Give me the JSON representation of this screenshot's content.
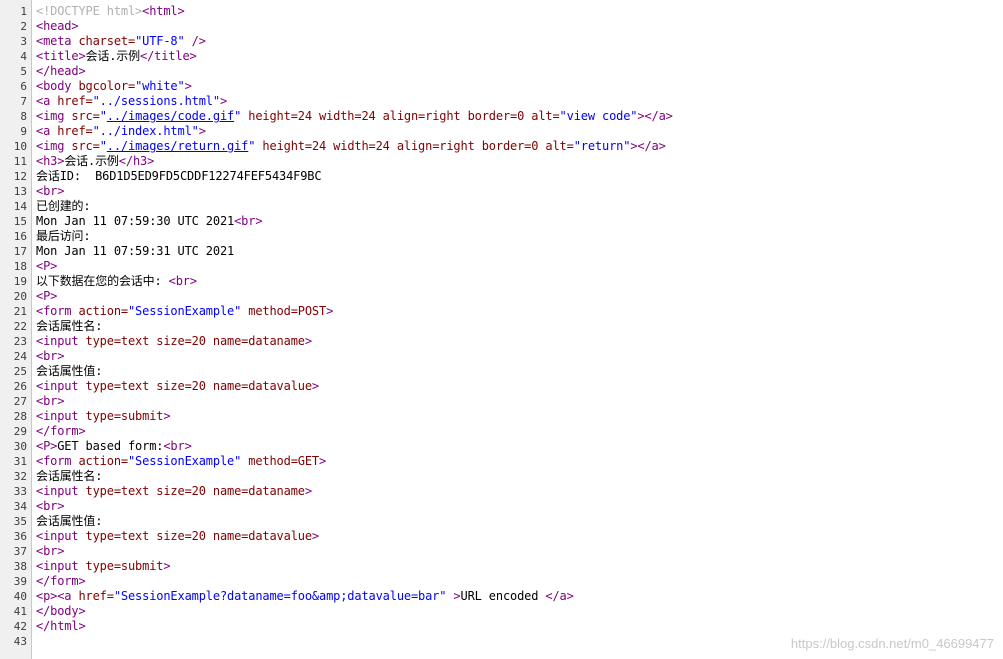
{
  "colors": {
    "tag": "#800080",
    "attribute": "#800000",
    "string": "#0000ff",
    "doctype": "#b0b0b0",
    "text": "#000000",
    "gutter_bg": "#f0f0f0"
  },
  "lines": [
    {
      "n": "1",
      "tokens": [
        [
          "dim",
          "<!DOCTYPE html>"
        ],
        [
          "tag",
          "<html>"
        ]
      ]
    },
    {
      "n": "2",
      "tokens": [
        [
          "tag",
          "<head>"
        ]
      ]
    },
    {
      "n": "3",
      "tokens": [
        [
          "tag",
          "<meta "
        ],
        [
          "attr",
          "charset="
        ],
        [
          "val",
          "\"UTF-8\""
        ],
        [
          "tag",
          " />"
        ]
      ]
    },
    {
      "n": "4",
      "tokens": [
        [
          "tag",
          "<title>"
        ],
        [
          "txt",
          "会话.示例"
        ],
        [
          "tag",
          "</title>"
        ]
      ]
    },
    {
      "n": "5",
      "tokens": [
        [
          "tag",
          "</head>"
        ]
      ]
    },
    {
      "n": "6",
      "tokens": [
        [
          "tag",
          "<body "
        ],
        [
          "attr",
          "bgcolor="
        ],
        [
          "val",
          "\"white\""
        ],
        [
          "tag",
          ">"
        ]
      ]
    },
    {
      "n": "7",
      "tokens": [
        [
          "tag",
          "<a "
        ],
        [
          "attr",
          "href="
        ],
        [
          "val",
          "\"../sessions.html\""
        ],
        [
          "tag",
          ">"
        ]
      ]
    },
    {
      "n": "8",
      "tokens": [
        [
          "tag",
          "<img "
        ],
        [
          "attr",
          "src="
        ],
        [
          "val",
          "\""
        ],
        [
          "link",
          "../images/code.gif"
        ],
        [
          "val",
          "\""
        ],
        [
          "attr",
          " height=24 width=24 align=right border=0 alt="
        ],
        [
          "val",
          "\"view code\""
        ],
        [
          "tag",
          "></a>"
        ]
      ]
    },
    {
      "n": "9",
      "tokens": [
        [
          "tag",
          "<a "
        ],
        [
          "attr",
          "href="
        ],
        [
          "val",
          "\"../index.html\""
        ],
        [
          "tag",
          ">"
        ]
      ]
    },
    {
      "n": "10",
      "tokens": [
        [
          "tag",
          "<img "
        ],
        [
          "attr",
          "src="
        ],
        [
          "val",
          "\""
        ],
        [
          "link",
          "../images/return.gif"
        ],
        [
          "val",
          "\""
        ],
        [
          "attr",
          " height=24 width=24 align=right border=0 alt="
        ],
        [
          "val",
          "\"return\""
        ],
        [
          "tag",
          "></a>"
        ]
      ]
    },
    {
      "n": "11",
      "tokens": [
        [
          "tag",
          "<h3>"
        ],
        [
          "txt",
          "会话.示例"
        ],
        [
          "tag",
          "</h3>"
        ]
      ]
    },
    {
      "n": "12",
      "tokens": [
        [
          "txt",
          "会话ID:  B6D1D5ED9FD5CDDF12274FEF5434F9BC"
        ]
      ]
    },
    {
      "n": "13",
      "tokens": [
        [
          "tag",
          "<br>"
        ]
      ]
    },
    {
      "n": "14",
      "tokens": [
        [
          "txt",
          "已创建的:"
        ]
      ]
    },
    {
      "n": "15",
      "tokens": [
        [
          "txt",
          "Mon Jan 11 07:59:30 UTC 2021"
        ],
        [
          "tag",
          "<br>"
        ]
      ]
    },
    {
      "n": "16",
      "tokens": [
        [
          "txt",
          "最后访问:"
        ]
      ]
    },
    {
      "n": "17",
      "tokens": [
        [
          "txt",
          "Mon Jan 11 07:59:31 UTC 2021"
        ]
      ]
    },
    {
      "n": "18",
      "tokens": [
        [
          "tag",
          "<P>"
        ]
      ]
    },
    {
      "n": "19",
      "tokens": [
        [
          "txt",
          "以下数据在您的会话中: "
        ],
        [
          "tag",
          "<br>"
        ]
      ]
    },
    {
      "n": "20",
      "tokens": [
        [
          "tag",
          "<P>"
        ]
      ]
    },
    {
      "n": "21",
      "tokens": [
        [
          "tag",
          "<form "
        ],
        [
          "attr",
          "action="
        ],
        [
          "val",
          "\"SessionExample\""
        ],
        [
          "attr",
          " method=POST"
        ],
        [
          "tag",
          ">"
        ]
      ]
    },
    {
      "n": "22",
      "tokens": [
        [
          "txt",
          "会话属性名:"
        ]
      ]
    },
    {
      "n": "23",
      "tokens": [
        [
          "tag",
          "<input "
        ],
        [
          "attr",
          "type=text size=20 name=dataname"
        ],
        [
          "tag",
          ">"
        ]
      ]
    },
    {
      "n": "24",
      "tokens": [
        [
          "tag",
          "<br>"
        ]
      ]
    },
    {
      "n": "25",
      "tokens": [
        [
          "txt",
          "会话属性值:"
        ]
      ]
    },
    {
      "n": "26",
      "tokens": [
        [
          "tag",
          "<input "
        ],
        [
          "attr",
          "type=text size=20 name=datavalue"
        ],
        [
          "tag",
          ">"
        ]
      ]
    },
    {
      "n": "27",
      "tokens": [
        [
          "tag",
          "<br>"
        ]
      ]
    },
    {
      "n": "28",
      "tokens": [
        [
          "tag",
          "<input "
        ],
        [
          "attr",
          "type=submit"
        ],
        [
          "tag",
          ">"
        ]
      ]
    },
    {
      "n": "29",
      "tokens": [
        [
          "tag",
          "</form>"
        ]
      ]
    },
    {
      "n": "30",
      "tokens": [
        [
          "tag",
          "<P>"
        ],
        [
          "txt",
          "GET based form:"
        ],
        [
          "tag",
          "<br>"
        ]
      ]
    },
    {
      "n": "31",
      "tokens": [
        [
          "tag",
          "<form "
        ],
        [
          "attr",
          "action="
        ],
        [
          "val",
          "\"SessionExample\""
        ],
        [
          "attr",
          " method=GET"
        ],
        [
          "tag",
          ">"
        ]
      ]
    },
    {
      "n": "32",
      "tokens": [
        [
          "txt",
          "会话属性名:"
        ]
      ]
    },
    {
      "n": "33",
      "tokens": [
        [
          "tag",
          "<input "
        ],
        [
          "attr",
          "type=text size=20 name=dataname"
        ],
        [
          "tag",
          ">"
        ]
      ]
    },
    {
      "n": "34",
      "tokens": [
        [
          "tag",
          "<br>"
        ]
      ]
    },
    {
      "n": "35",
      "tokens": [
        [
          "txt",
          "会话属性值:"
        ]
      ]
    },
    {
      "n": "36",
      "tokens": [
        [
          "tag",
          "<input "
        ],
        [
          "attr",
          "type=text size=20 name=datavalue"
        ],
        [
          "tag",
          ">"
        ]
      ]
    },
    {
      "n": "37",
      "tokens": [
        [
          "tag",
          "<br>"
        ]
      ]
    },
    {
      "n": "38",
      "tokens": [
        [
          "tag",
          "<input "
        ],
        [
          "attr",
          "type=submit"
        ],
        [
          "tag",
          ">"
        ]
      ]
    },
    {
      "n": "39",
      "tokens": [
        [
          "tag",
          "</form>"
        ]
      ]
    },
    {
      "n": "40",
      "tokens": [
        [
          "tag",
          "<p><a "
        ],
        [
          "attr",
          "href="
        ],
        [
          "val",
          "\"SessionExample?dataname=foo&amp;datavalue=bar\""
        ],
        [
          "tag",
          " >"
        ],
        [
          "txt",
          "URL encoded "
        ],
        [
          "tag",
          "</a>"
        ]
      ]
    },
    {
      "n": "41",
      "tokens": [
        [
          "tag",
          "</body>"
        ]
      ]
    },
    {
      "n": "42",
      "tokens": [
        [
          "tag",
          "</html>"
        ]
      ]
    },
    {
      "n": "43",
      "tokens": []
    }
  ],
  "watermark": "https://blog.csdn.net/m0_46699477"
}
